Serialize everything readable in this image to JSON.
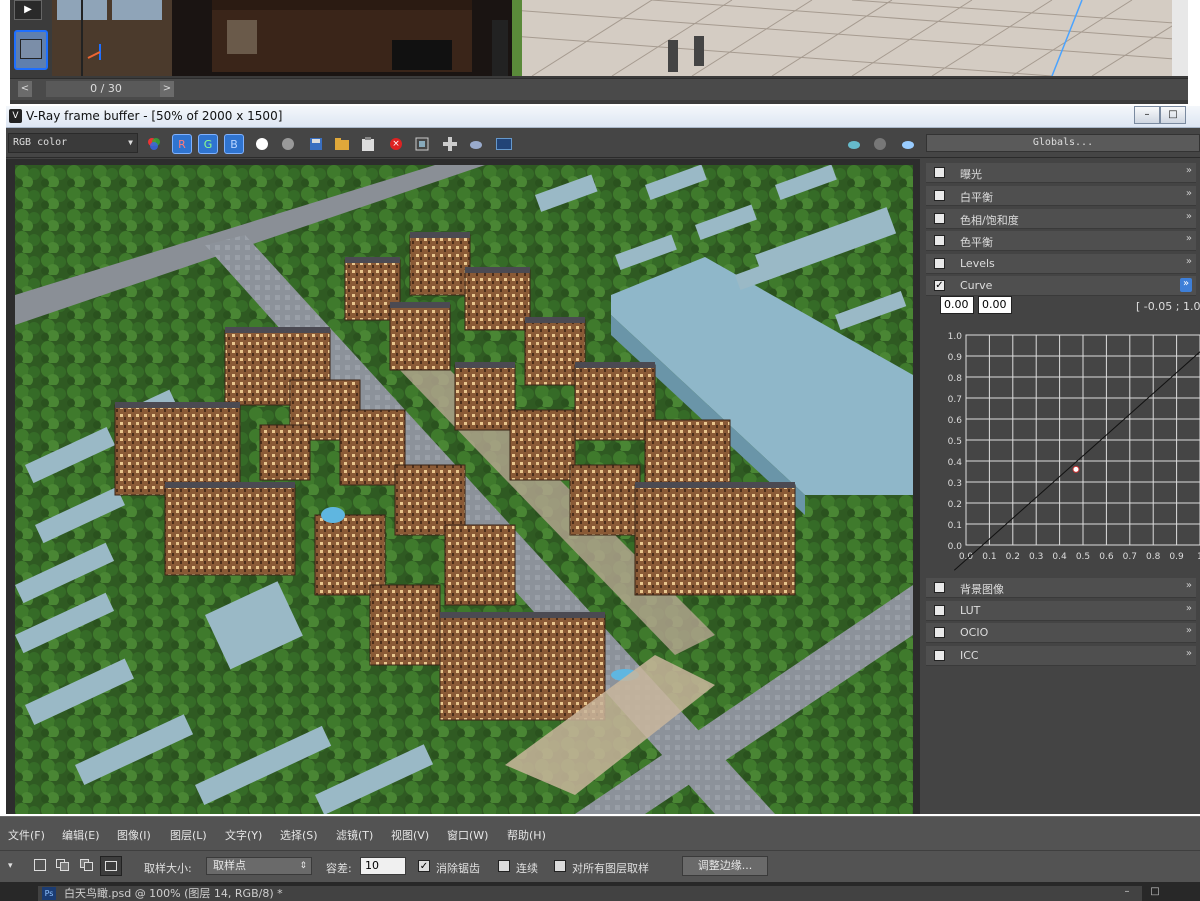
{
  "timeline": {
    "frame": "0 / 30"
  },
  "vfb": {
    "title": "V-Ray frame buffer - [50% of 2000 x 1500]",
    "channel": "RGB color",
    "r_label": "R",
    "g_label": "G",
    "b_label": "B",
    "globals_label": "Globals...",
    "icon_letter": "V"
  },
  "corrections": {
    "items": [
      {
        "label": "曝光",
        "checked": false
      },
      {
        "label": "白平衡",
        "checked": false
      },
      {
        "label": "色相/饱和度",
        "checked": false
      },
      {
        "label": "色平衡",
        "checked": false
      },
      {
        "label": "Levels",
        "checked": false
      },
      {
        "label": "Curve",
        "checked": true
      }
    ],
    "curve_x": "0.00",
    "curve_y": "0.00",
    "range": "[ -0.05 ; 1.0",
    "items_after": [
      {
        "label": "背景图像",
        "checked": false
      },
      {
        "label": "LUT",
        "checked": false
      },
      {
        "label": "OCIO",
        "checked": false
      },
      {
        "label": "ICC",
        "checked": false
      }
    ]
  },
  "curve_chart": {
    "y_ticks": [
      "1.0",
      "0.9",
      "0.8",
      "0.7",
      "0.6",
      "0.5",
      "0.4",
      "0.3",
      "0.2",
      "0.1",
      "0.0"
    ],
    "x_ticks": [
      "0.0",
      "0.1",
      "0.2",
      "0.3",
      "0.4",
      "0.5",
      "0.6",
      "0.7",
      "0.8",
      "0.9",
      "1"
    ],
    "line_points": [
      [
        -0.05,
        -0.12
      ],
      [
        1.0,
        0.92
      ]
    ],
    "control_point": [
      0.47,
      0.36
    ]
  },
  "ps": {
    "menu": [
      "文件(F)",
      "编辑(E)",
      "图像(I)",
      "图层(L)",
      "文字(Y)",
      "选择(S)",
      "滤镜(T)",
      "视图(V)",
      "窗口(W)",
      "帮助(H)"
    ],
    "sample_size_label": "取样大小:",
    "sample_size_value": "取样点",
    "tolerance_label": "容差:",
    "tolerance_value": "10",
    "antialias_label": "消除锯齿",
    "contiguous_label": "连续",
    "all_layers_label": "对所有图层取样",
    "refine_label": "调整边缘...",
    "doc_tab": "白天鸟瞰.psd @ 100% (图层 14, RGB/8) *",
    "app_icon": "Ps"
  },
  "colors": {
    "accent": "#2f74d0",
    "panel": "#444444"
  }
}
